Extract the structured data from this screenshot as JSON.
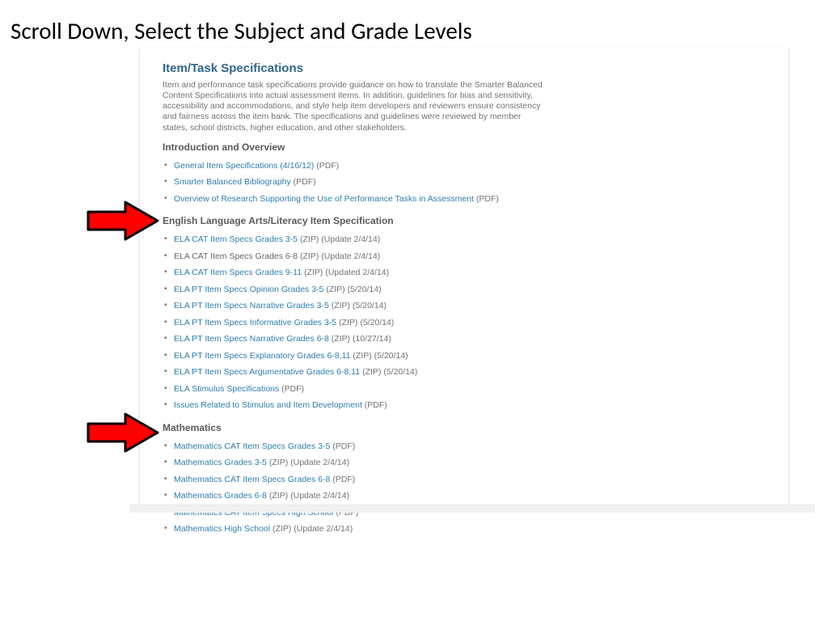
{
  "slide_title": "Scroll Down, Select the Subject and Grade Levels",
  "card": {
    "title": "Item/Task Specifications",
    "intro": "Item and performance task specifications provide guidance on how to translate the Smarter Balanced Content Specifications into actual assessment items. In addition, guidelines for bias and sensitivity, accessibility and accommodations, and style help item developers and reviewers ensure consistency and fairness across the item bank. The specifications and guidelines were reviewed by member states, school districts, higher education, and other stakeholders.",
    "sections": [
      {
        "heading": "Introduction and Overview",
        "items": [
          {
            "link": "General Item Specifications (4/16/12)",
            "suffix": " (PDF)",
            "visited": false
          },
          {
            "link": "Smarter Balanced Bibliography",
            "suffix": " (PDF)",
            "visited": false
          },
          {
            "link": "Overview of Research Supporting the Use of Performance Tasks in Assessment",
            "suffix": " (PDF)",
            "visited": false
          }
        ]
      },
      {
        "heading": "English Language Arts/Literacy Item Specification",
        "items": [
          {
            "link": "ELA CAT Item Specs Grades 3-5",
            "suffix": " (ZIP) (Update 2/4/14)",
            "visited": false
          },
          {
            "link": "ELA CAT Item Specs Grades 6-8",
            "suffix": " (ZIP) (Update 2/4/14)",
            "visited": true
          },
          {
            "link": "ELA CAT Item Specs Grades 9-11",
            "suffix": " (ZIP) (Updated 2/4/14)",
            "visited": false
          },
          {
            "link": "ELA PT Item Specs Opinion Grades 3-5",
            "suffix": " (ZIP) (5/20/14)",
            "visited": false
          },
          {
            "link": "ELA PT Item Specs Narrative Grades 3-5",
            "suffix": " (ZIP) (5/20/14)",
            "visited": false
          },
          {
            "link": "ELA PT Item Specs Informative Grades 3-5",
            "suffix": " (ZIP) (5/20/14)",
            "visited": false
          },
          {
            "link": "ELA PT Item Specs Narrative Grades 6-8",
            "suffix": " (ZIP) (10/27/14)",
            "visited": false
          },
          {
            "link": "ELA PT Item Specs Explanatory Grades 6-8,11",
            "suffix": " (ZIP) (5/20/14)",
            "visited": false
          },
          {
            "link": "ELA PT Item Specs Argumentative Grades 6-8,11",
            "suffix": " (ZIP) (5/20/14)",
            "visited": false
          },
          {
            "link": "ELA Stimulus Specifications",
            "suffix": " (PDF)",
            "visited": false
          },
          {
            "link": "Issues Related to Stimulus and Item Development",
            "suffix": " (PDF)",
            "visited": false
          }
        ]
      },
      {
        "heading": "Mathematics",
        "items": [
          {
            "link": "Mathematics CAT Item Specs Grades 3-5",
            "suffix": " (PDF)",
            "visited": false
          },
          {
            "link": "Mathematics Grades 3-5",
            "suffix": " (ZIP) (Update 2/4/14)",
            "visited": false
          },
          {
            "link": "Mathematics CAT Item Specs Grades 6-8",
            "suffix": " (PDF)",
            "visited": false
          },
          {
            "link": "Mathematics Grades 6-8",
            "suffix": " (ZIP) (Update 2/4/14)",
            "visited": false
          },
          {
            "link": "Mathematics CAT Item Specs High School",
            "suffix": " (PDF)",
            "visited": false
          },
          {
            "link": "Mathematics High School",
            "suffix": " (ZIP) (Update 2/4/14)",
            "visited": false
          }
        ]
      }
    ]
  }
}
